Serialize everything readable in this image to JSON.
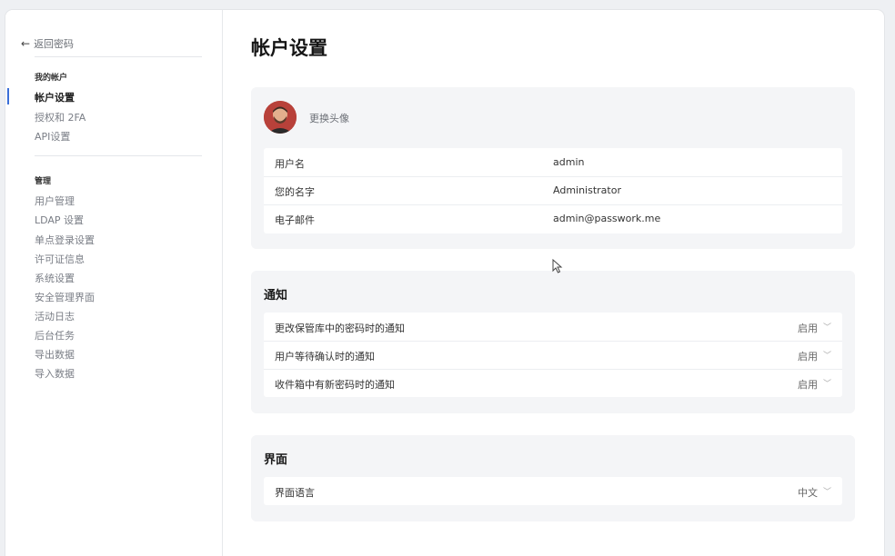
{
  "sidebar": {
    "back_label": "返回密码",
    "my_account_title": "我的帐户",
    "my_account_items": [
      "帐户设置",
      "授权和 2FA",
      "API设置"
    ],
    "manage_title": "管理",
    "manage_items": [
      "用户管理",
      "LDAP 设置",
      "单点登录设置",
      "许可证信息",
      "系统设置",
      "安全管理界面",
      "活动日志",
      "后台任务",
      "导出数据",
      "导入数据"
    ]
  },
  "page": {
    "title": "帐户设置"
  },
  "profile": {
    "change_avatar": "更换头像",
    "rows": [
      {
        "label": "用户名",
        "value": "admin"
      },
      {
        "label": "您的名字",
        "value": "Administrator"
      },
      {
        "label": "电子邮件",
        "value": "admin@passwork.me"
      }
    ]
  },
  "notifications": {
    "title": "通知",
    "rows": [
      {
        "label": "更改保管库中的密码时的通知",
        "value": "启用"
      },
      {
        "label": "用户等待确认时的通知",
        "value": "启用"
      },
      {
        "label": "收件箱中有新密码时的通知",
        "value": "启用"
      }
    ]
  },
  "interface": {
    "title": "界面",
    "rows": [
      {
        "label": "界面语言",
        "value": "中文"
      }
    ]
  },
  "colors": {
    "accent": "#3a6fd8",
    "card_bg": "#f4f5f7"
  }
}
